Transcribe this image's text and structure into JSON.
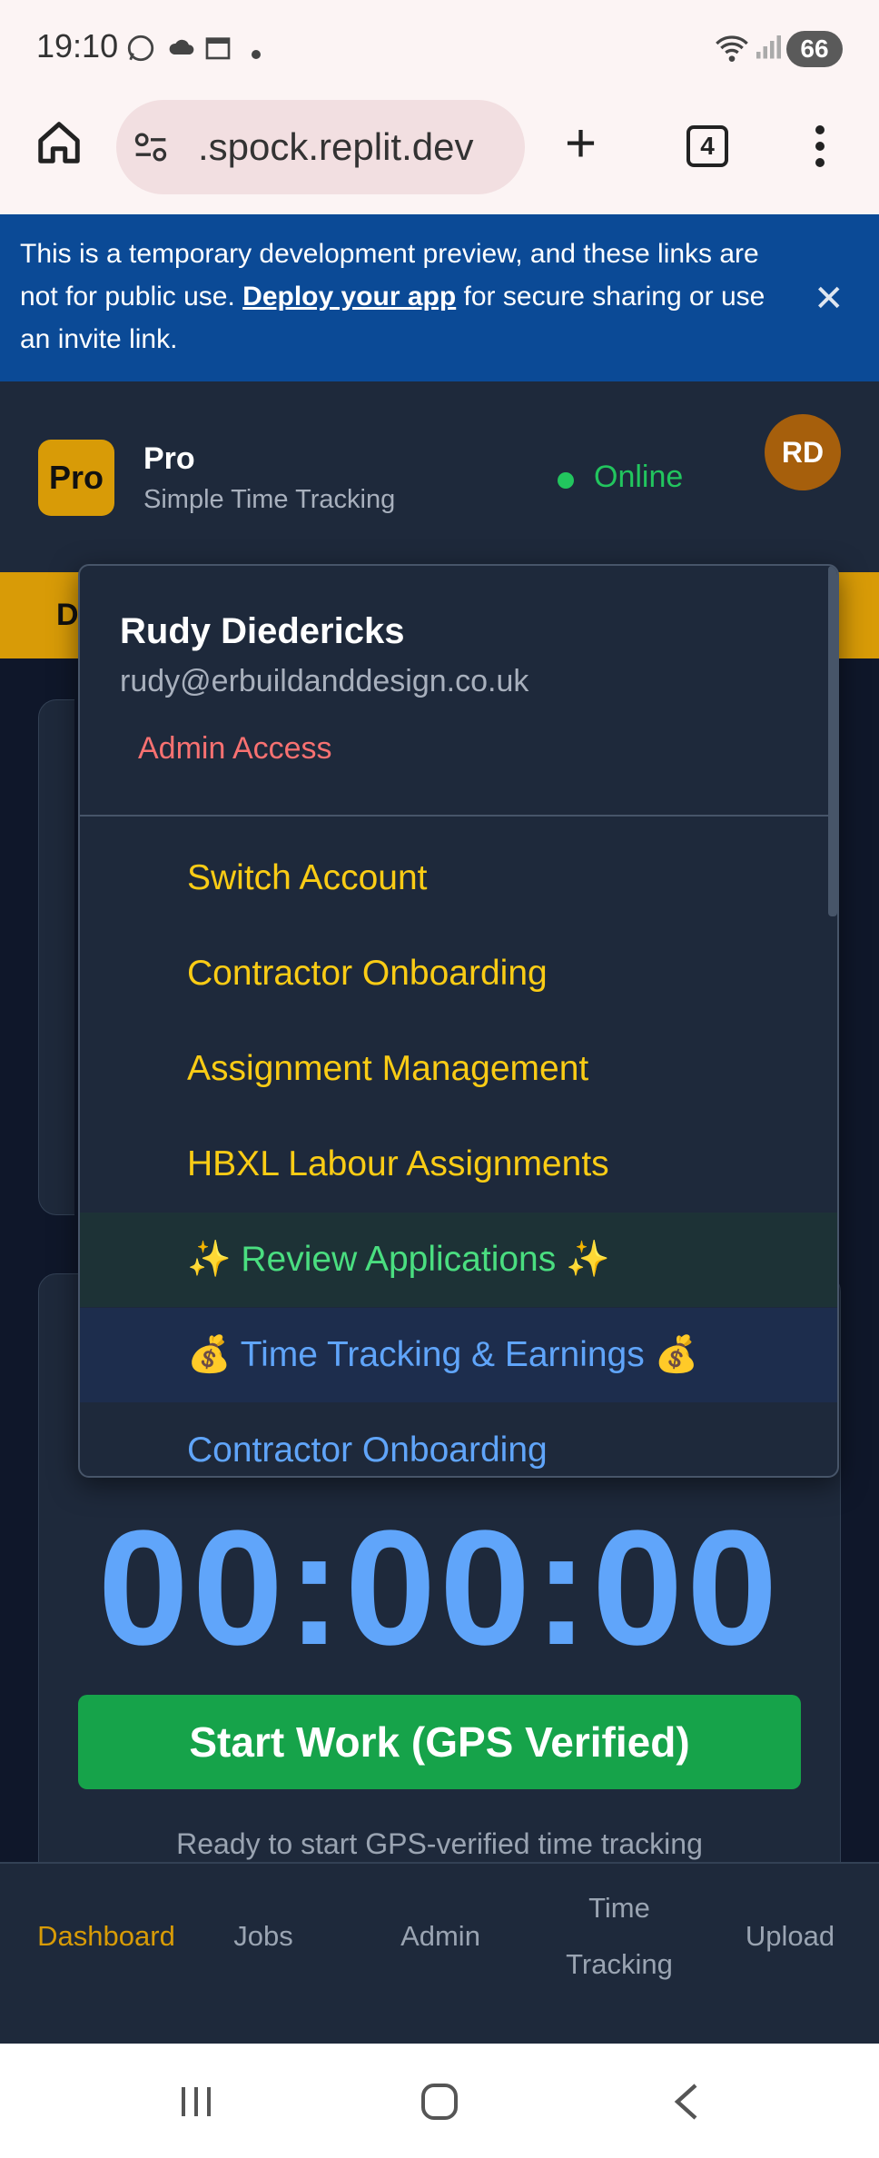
{
  "status_bar": {
    "time": "19:10",
    "battery": "66"
  },
  "browser": {
    "url": ".spock.replit.dev",
    "tab_count": "4"
  },
  "banner": {
    "text_before": "This is a temporary development preview, and these links are not for public use. ",
    "link": "Deploy your app",
    "text_after": " for secure sharing or use an invite link."
  },
  "header": {
    "logo": "Pro",
    "brand": "Pro",
    "tagline": "Simple Time Tracking",
    "status": "Online",
    "avatar": "RD"
  },
  "nav_strip": {
    "partial_label": "D"
  },
  "user_menu": {
    "name": "Rudy Diedericks",
    "email": "rudy@erbuildanddesign.co.uk",
    "access": "Admin Access",
    "items": [
      {
        "label": "Switch Account"
      },
      {
        "label": "Contractor Onboarding"
      },
      {
        "label": "Assignment Management"
      },
      {
        "label": "HBXL Labour Assignments"
      },
      {
        "label": "✨ Review Applications ✨"
      },
      {
        "label": "💰 Time Tracking & Earnings 💰"
      },
      {
        "label": "Contractor Onboarding"
      }
    ]
  },
  "timer": {
    "display": "00:00:00",
    "start_button": "Start Work (GPS Verified)",
    "ready_text": "Ready to start GPS-verified time tracking"
  },
  "bottom_nav": {
    "dashboard": "Dashboard",
    "jobs": "Jobs",
    "admin": "Admin",
    "time_tracking_line1": "Time",
    "time_tracking_line2": "Tracking",
    "upload": "Upload"
  },
  "colors": {
    "accent": "#d89b07",
    "online": "#22c55e",
    "timer": "#60a5fa",
    "start_button": "#16a34a",
    "menu_item": "#facc15",
    "banner": "#0b4a96"
  }
}
